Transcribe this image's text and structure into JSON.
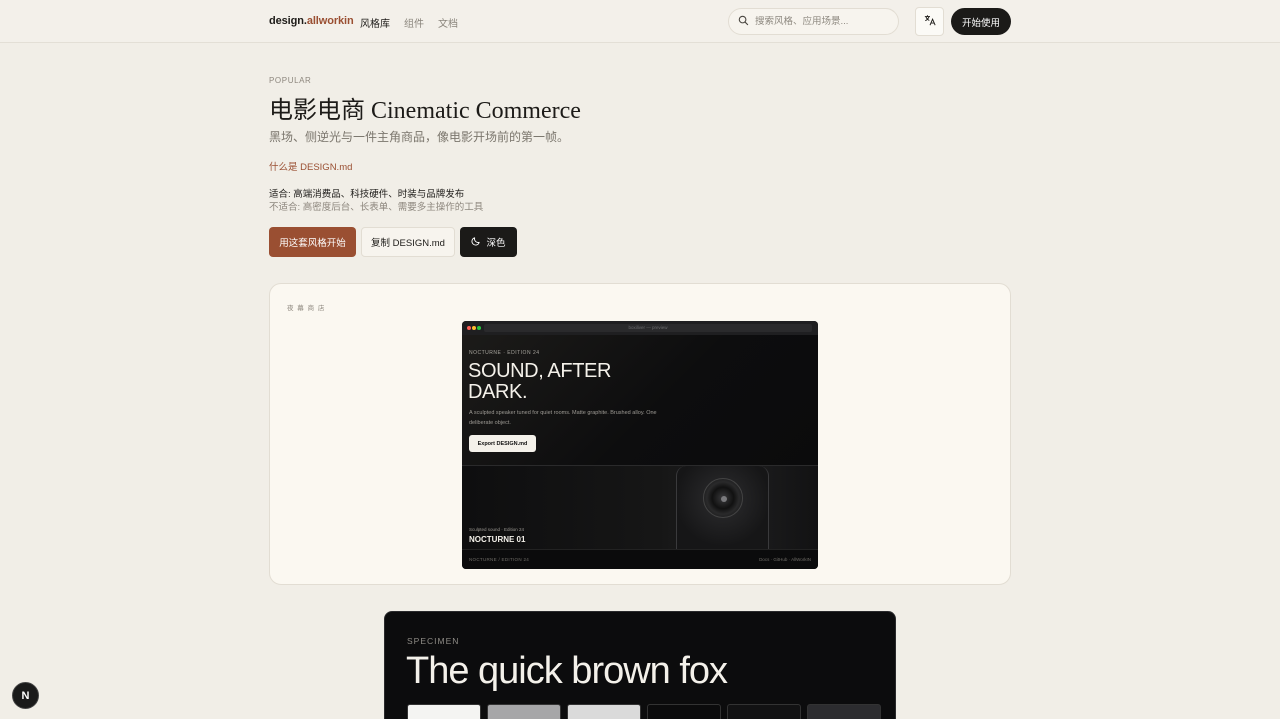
{
  "header": {
    "logo_main": "design.",
    "logo_accent": "allworkin",
    "nav": [
      "风格库",
      "组件",
      "文档"
    ],
    "search_placeholder": "搜索风格、应用场景...",
    "lang_icon": "translate-icon",
    "start_label": "开始使用"
  },
  "hero": {
    "eyebrow": "POPULAR",
    "title": "电影电商 Cinematic Commerce",
    "subtitle": "黑场、侧逆光与一件主角商品，像电影开场前的第一帧。",
    "what_link": "什么是 DESIGN.md",
    "fit": "适合: 高端消费品、科技硬件、时装与品牌发布",
    "unfit": "不适合: 高密度后台、长表单、需要多主操作的工具",
    "buttons": {
      "primary": "用这套风格开始",
      "copy": "复制 DESIGN.md",
      "dark": "深色"
    }
  },
  "preview": {
    "label": "夜 幕 商 店",
    "url": "boxiliver — preview",
    "edition": "NOCTURNE · EDITION 24",
    "headline": "SOUND, AFTER DARK.",
    "desc": "A sculpted speaker tuned for quiet rooms. Matte graphite. Brushed alloy. One deliberate object.",
    "export_label": "Export DESIGN.md",
    "product_sub": "Sculpted sound · Edition 24",
    "product_name": "NOCTURNE 01",
    "footer_left": "NOCTURNE / EDITION 24",
    "footer_right": "Docs · GitHub · AllWorkIN"
  },
  "specimen": {
    "label": "SPECIMEN",
    "title": "The quick brown fox",
    "swatches": [
      "#f4f4f2",
      "#a6a6a8",
      "#dadada",
      "#0b0b0c",
      "#121213",
      "#2c2c2f"
    ]
  },
  "badge": "N",
  "colors": {
    "accent": "#9a4f32",
    "background": "#f1eee7",
    "dark": "#1b1a18"
  }
}
